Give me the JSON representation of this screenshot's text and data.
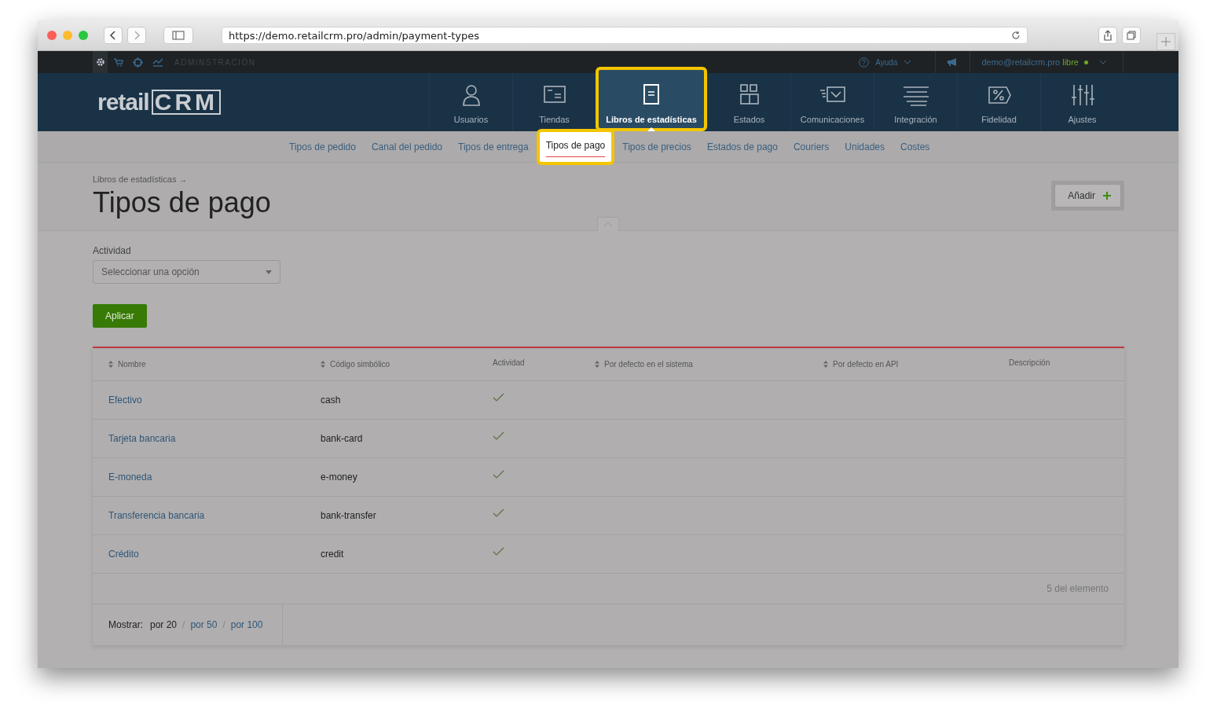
{
  "browser": {
    "url": "https://demo.retailcrm.pro/admin/payment-types"
  },
  "topbar": {
    "section": "ADMINSTRACIÓN",
    "help": "Ayuda",
    "user": "demo@retailcrm.pro",
    "plan": "libre"
  },
  "logo": {
    "text": "retail",
    "mark": "CRM"
  },
  "nav": [
    {
      "label": "Usuarios",
      "selected": false
    },
    {
      "label": "Tiendas",
      "selected": false
    },
    {
      "label": "Libros de estadísticas",
      "selected": true
    },
    {
      "label": "Estados",
      "selected": false
    },
    {
      "label": "Comunicaciones",
      "selected": false
    },
    {
      "label": "Integración",
      "selected": false
    },
    {
      "label": "Fidelidad",
      "selected": false
    },
    {
      "label": "Ajustes",
      "selected": false
    }
  ],
  "subnav": [
    {
      "label": "Tipos de pedido",
      "selected": false
    },
    {
      "label": "Canal del pedido",
      "selected": false
    },
    {
      "label": "Tipos de entrega",
      "selected": false
    },
    {
      "label": "Tipos de pago",
      "selected": true
    },
    {
      "label": "Tipos de precios",
      "selected": false
    },
    {
      "label": "Estados de pago",
      "selected": false
    },
    {
      "label": "Couriers",
      "selected": false
    },
    {
      "label": "Unidades",
      "selected": false
    },
    {
      "label": "Costes",
      "selected": false
    }
  ],
  "breadcrumb": "Libros de estadísticas →",
  "title": "Tipos de pago",
  "add_button": "Añadir",
  "filter": {
    "label": "Actividad",
    "placeholder": "Seleccionar una opción"
  },
  "apply_button": "Aplicar",
  "table": {
    "columns": [
      {
        "label": "Nombre",
        "sortable": true
      },
      {
        "label": "Código simbólico",
        "sortable": true
      },
      {
        "label": "Actividad",
        "sortable": false
      },
      {
        "label": "Por defecto en el sistema",
        "sortable": true
      },
      {
        "label": "Por defecto en API",
        "sortable": true
      },
      {
        "label": "Descripción",
        "sortable": false
      }
    ],
    "rows": [
      {
        "name": "Efectivo",
        "code": "cash",
        "active": true
      },
      {
        "name": "Tarjeta bancaria",
        "code": "bank-card",
        "active": true
      },
      {
        "name": "E-moneda",
        "code": "e-money",
        "active": true
      },
      {
        "name": "Transferencia bancaria",
        "code": "bank-transfer",
        "active": true
      },
      {
        "name": "Crédito",
        "code": "credit",
        "active": true
      }
    ],
    "count": "5 del elemento"
  },
  "page_size": {
    "label": "Mostrar:",
    "separator": "/",
    "options": [
      {
        "label": "por 20",
        "selected": true
      },
      {
        "label": "por 50",
        "selected": false
      },
      {
        "label": "por 100",
        "selected": false
      }
    ]
  }
}
